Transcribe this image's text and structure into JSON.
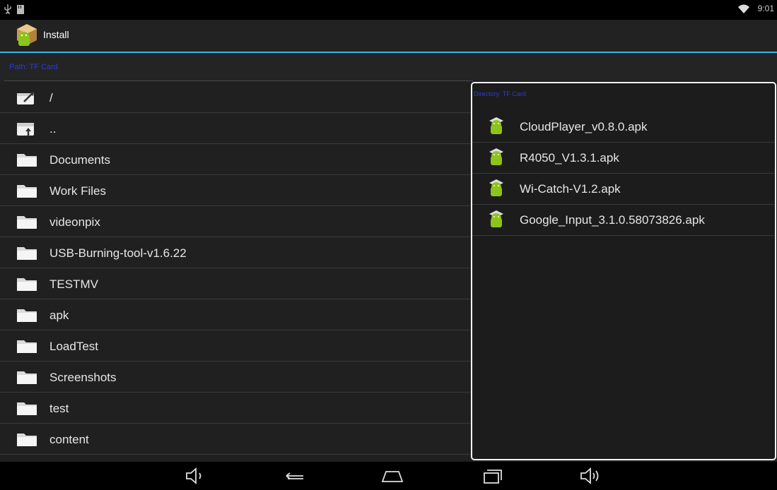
{
  "status_bar": {
    "time": "9:01"
  },
  "action_bar": {
    "title": "Install"
  },
  "path_bar": {
    "label": "Path:  TF Card"
  },
  "file_list": [
    {
      "name": "/",
      "icon": "root-folder-icon"
    },
    {
      "name": "..",
      "icon": "parent-folder-icon"
    },
    {
      "name": "Documents",
      "icon": "folder-icon"
    },
    {
      "name": "Work Files",
      "icon": "folder-icon"
    },
    {
      "name": "videonpix",
      "icon": "folder-icon"
    },
    {
      "name": "USB-Burning-tool-v1.6.22",
      "icon": "folder-icon"
    },
    {
      "name": "TESTMV",
      "icon": "folder-icon"
    },
    {
      "name": "apk",
      "icon": "folder-icon"
    },
    {
      "name": "LoadTest",
      "icon": "folder-icon"
    },
    {
      "name": "Screenshots",
      "icon": "folder-icon"
    },
    {
      "name": "test",
      "icon": "folder-icon"
    },
    {
      "name": "content",
      "icon": "folder-icon"
    }
  ],
  "apk_panel": {
    "title": "Directory:  TF Card",
    "items": [
      {
        "name": "CloudPlayer_v0.8.0.apk"
      },
      {
        "name": "R4050_V1.3.1.apk"
      },
      {
        "name": "Wi-Catch-V1.2.apk"
      },
      {
        "name": "Google_Input_3.1.0.58073826.apk"
      }
    ]
  },
  "colors": {
    "accent": "#33b5e5",
    "path_text": "#2b3cd6",
    "background": "#202020"
  }
}
